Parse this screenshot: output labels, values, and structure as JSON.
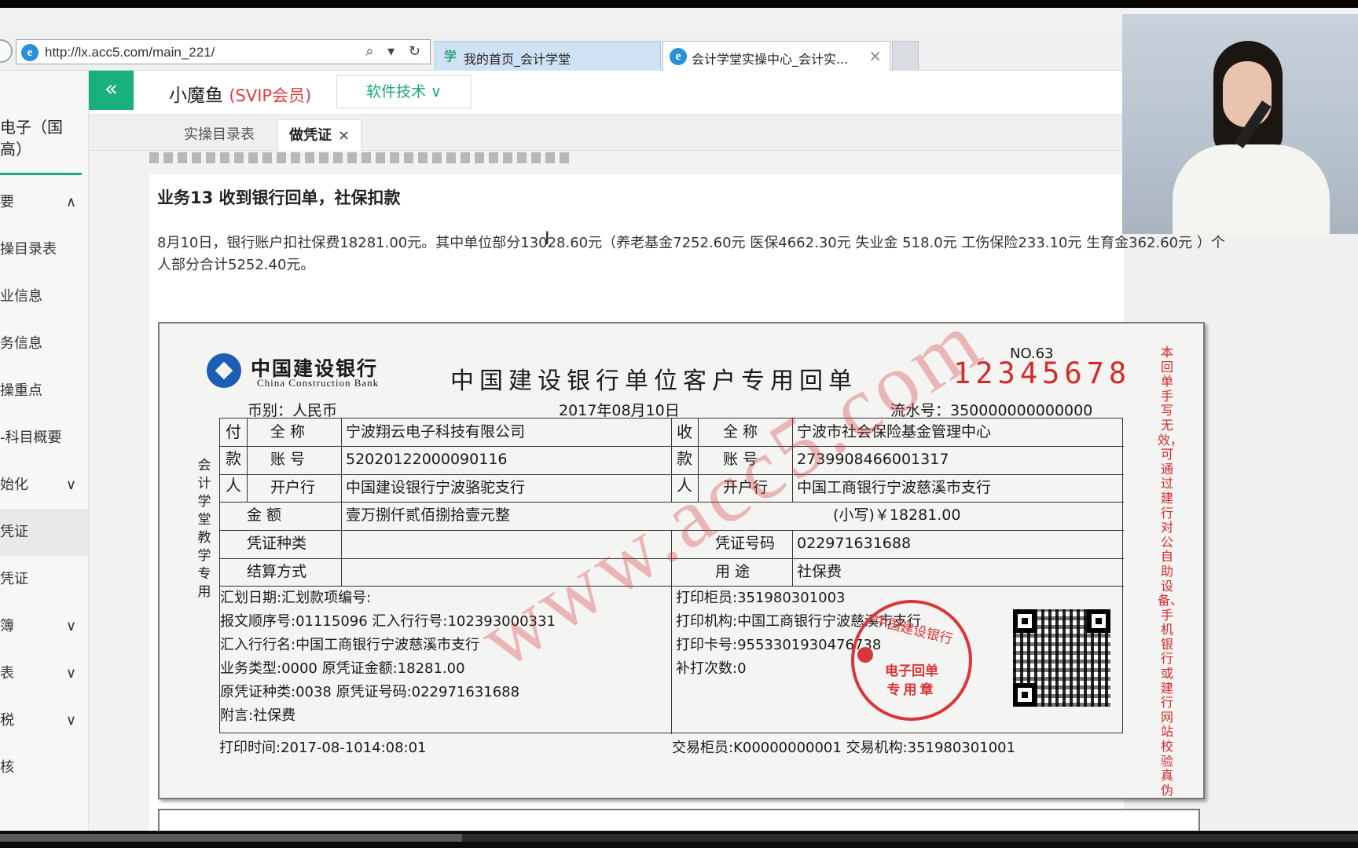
{
  "browser": {
    "url": "http://lx.acc5.com/main_221/",
    "tools": "⌕ ▾ ↻",
    "tabs": [
      {
        "label": "我的首页_会计学堂",
        "icon": "学"
      },
      {
        "label": "会计学堂实操中心_会计实...",
        "icon": "e",
        "close": "×"
      }
    ]
  },
  "header": {
    "collapse": "«",
    "user_name": "小魔鱼",
    "user_level": "(SVIP会员)",
    "software_button": "软件技术 ∨"
  },
  "subtabs": {
    "catalog": "实操目录表",
    "voucher": "做凭证",
    "close": "×"
  },
  "sidebar": {
    "heading": "电子（国\n高）",
    "items": [
      {
        "label": "要",
        "chevron": "∧"
      },
      {
        "label": "操目录表",
        "chevron": ""
      },
      {
        "label": "业信息",
        "chevron": ""
      },
      {
        "label": "务信息",
        "chevron": ""
      },
      {
        "label": "操重点",
        "chevron": ""
      },
      {
        "label": "-科目概要",
        "chevron": ""
      },
      {
        "label": "始化",
        "chevron": "∨"
      },
      {
        "label": "凭证",
        "chevron": ""
      },
      {
        "label": "凭证",
        "chevron": ""
      },
      {
        "label": "簿",
        "chevron": "∨"
      },
      {
        "label": "表",
        "chevron": "∨"
      },
      {
        "label": "税",
        "chevron": "∨"
      },
      {
        "label": "核",
        "chevron": ""
      }
    ]
  },
  "business": {
    "title": "业务13 收到银行回单，社保扣款",
    "description": "8月10日，银行账户扣社保费18281.00元。其中单位部分13028.60元（养老基金7252.60元  医保4662.30元  失业金 518.0元  工伤保险233.10元 生育金362.60元 ）个人部分合计5252.40元。"
  },
  "receipt": {
    "bank_name_cn": "中国建设银行",
    "bank_name_en": "China  Construction  Bank",
    "title": "中国建设银行单位客户专用回单",
    "no_label": "NO.63",
    "serial_no": "12345678",
    "currency": "币别：人民币",
    "date": "2017年08月10日",
    "flow_no": "流水号：350000000000000",
    "side_note": "本回单手写无效，可通过建行对公自助设备、手机银行或建行网站校验真伪",
    "left_vertical": "会计学堂教学专用",
    "payer_label": "付款人",
    "payee_label": "收款人",
    "field_full_name": "全  称",
    "field_account": "账  号",
    "field_bank": "开户行",
    "payer_name": "宁波翔云电子科技有限公司",
    "payer_account": "52020122000090116",
    "payer_bank": "中国建设银行宁波骆驼支行",
    "payee_name": "宁波市社会保险基金管理中心",
    "payee_account": "2739908466001317",
    "payee_bank": "中国工商银行宁波慈溪市支行",
    "amount_label": "金    额",
    "amount_words": "壹万捌仟贰佰捌拾壹元整",
    "amount_small": "(小写)￥18281.00",
    "voucher_type_label": "凭证种类",
    "voucher_no_label": "凭证号码",
    "voucher_no": "022971631688",
    "settlement_label": "结算方式",
    "purpose_label": "用    途",
    "purpose": "社保费",
    "left_lines": [
      "汇划日期:汇划款项编号:",
      "报文顺序号:01115096 汇入行行号:102393000331",
      "汇入行行名:中国工商银行宁波慈溪市支行",
      "业务类型:0000 原凭证金额:18281.00",
      "原凭证种类:0038 原凭证号码:022971631688",
      "附言:社保费"
    ],
    "right_lines": [
      "打印柜员:351980301003",
      "打印机构:中国工商银行宁波慈溪市支行",
      "打印卡号:9553301930476738",
      "补打次数:0"
    ],
    "print_time": "打印时间:2017-08-1014:08:01",
    "trade_info": "交易柜员:K00000000001 交易机构:351980301001",
    "stamp_top": "中国建设银行",
    "stamp_mid": "电子回单",
    "stamp_bottom": "专用章",
    "watermark": "www.acc5.com"
  },
  "video": {
    "progress_percent": 34
  }
}
